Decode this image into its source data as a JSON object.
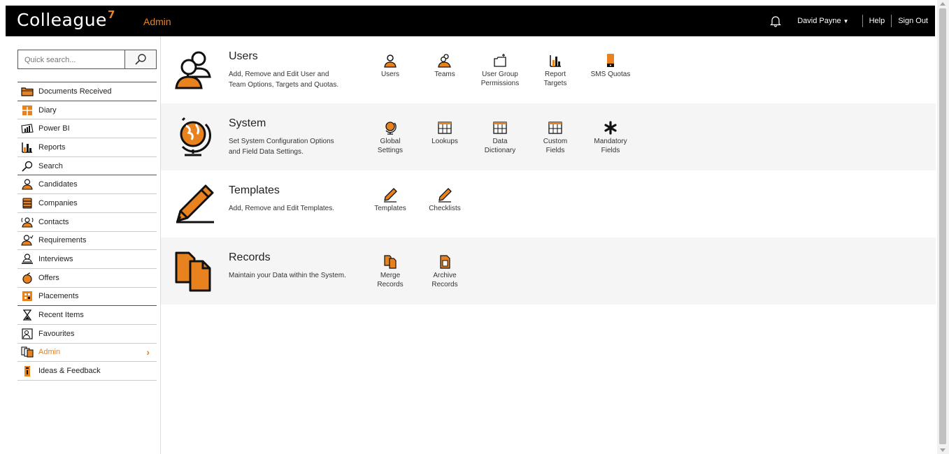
{
  "header": {
    "logo": "Colleague",
    "logo_mark": "7",
    "section_title": "Admin",
    "user_name": "David Payne",
    "help_label": "Help",
    "signout_label": "Sign Out"
  },
  "search": {
    "placeholder": "Quick search..."
  },
  "sidebar": {
    "items": [
      {
        "label": "Documents Received",
        "icon": "folder-icon"
      },
      {
        "label": "Diary",
        "icon": "calendar-icon"
      },
      {
        "label": "Power BI",
        "icon": "power-bi-icon"
      },
      {
        "label": "Reports",
        "icon": "bar-chart-icon"
      },
      {
        "label": "Search",
        "icon": "search-icon"
      },
      {
        "label": "Candidates",
        "icon": "person-icon"
      },
      {
        "label": "Companies",
        "icon": "building-icon"
      },
      {
        "label": "Contacts",
        "icon": "contact-icon"
      },
      {
        "label": "Requirements",
        "icon": "requirement-icon"
      },
      {
        "label": "Interviews",
        "icon": "interview-icon"
      },
      {
        "label": "Offers",
        "icon": "apple-icon"
      },
      {
        "label": "Placements",
        "icon": "placement-icon"
      },
      {
        "label": "Recent Items",
        "icon": "hourglass-icon"
      },
      {
        "label": "Favourites",
        "icon": "favourites-icon"
      },
      {
        "label": "Admin",
        "icon": "admin-icon",
        "active": true
      },
      {
        "label": "Ideas & Feedback",
        "icon": "idea-icon"
      }
    ]
  },
  "sections": [
    {
      "title": "Users",
      "desc_line1": "Add, Remove and Edit User and",
      "desc_line2": "Team Options, Targets and Quotas.",
      "tiles": [
        {
          "line1": "Users",
          "line2": "",
          "icon": "user-icon"
        },
        {
          "line1": "Teams",
          "line2": "",
          "icon": "team-icon"
        },
        {
          "line1": "User Group",
          "line2": "Permissions",
          "icon": "permissions-icon"
        },
        {
          "line1": "Report",
          "line2": "Targets",
          "icon": "report-targets-icon"
        },
        {
          "line1": "SMS Quotas",
          "line2": "",
          "icon": "phone-icon"
        }
      ]
    },
    {
      "title": "System",
      "desc_line1": "Set System Configuration Options",
      "desc_line2": "and Field Data Settings.",
      "tiles": [
        {
          "line1": "Global",
          "line2": "Settings",
          "icon": "globe-icon"
        },
        {
          "line1": "Lookups",
          "line2": "",
          "icon": "lookup-icon"
        },
        {
          "line1": "Data",
          "line2": "Dictionary",
          "icon": "dictionary-icon"
        },
        {
          "line1": "Custom",
          "line2": "Fields",
          "icon": "custom-fields-icon"
        },
        {
          "line1": "Mandatory",
          "line2": "Fields",
          "icon": "asterisk-icon"
        }
      ]
    },
    {
      "title": "Templates",
      "desc_line1": "Add, Remove and Edit Templates.",
      "desc_line2": "",
      "tiles": [
        {
          "line1": "Templates",
          "line2": "",
          "icon": "pencil-icon"
        },
        {
          "line1": "Checklists",
          "line2": "",
          "icon": "pencil-icon"
        }
      ]
    },
    {
      "title": "Records",
      "desc_line1": "Maintain your Data within the System.",
      "desc_line2": "",
      "tiles": [
        {
          "line1": "Merge",
          "line2": "Records",
          "icon": "merge-icon"
        },
        {
          "line1": "Archive",
          "line2": "Records",
          "icon": "archive-icon"
        }
      ]
    }
  ],
  "colors": {
    "accent": "#e8821e",
    "header_bg": "#000000",
    "section_grey": "#f5f5f5"
  }
}
